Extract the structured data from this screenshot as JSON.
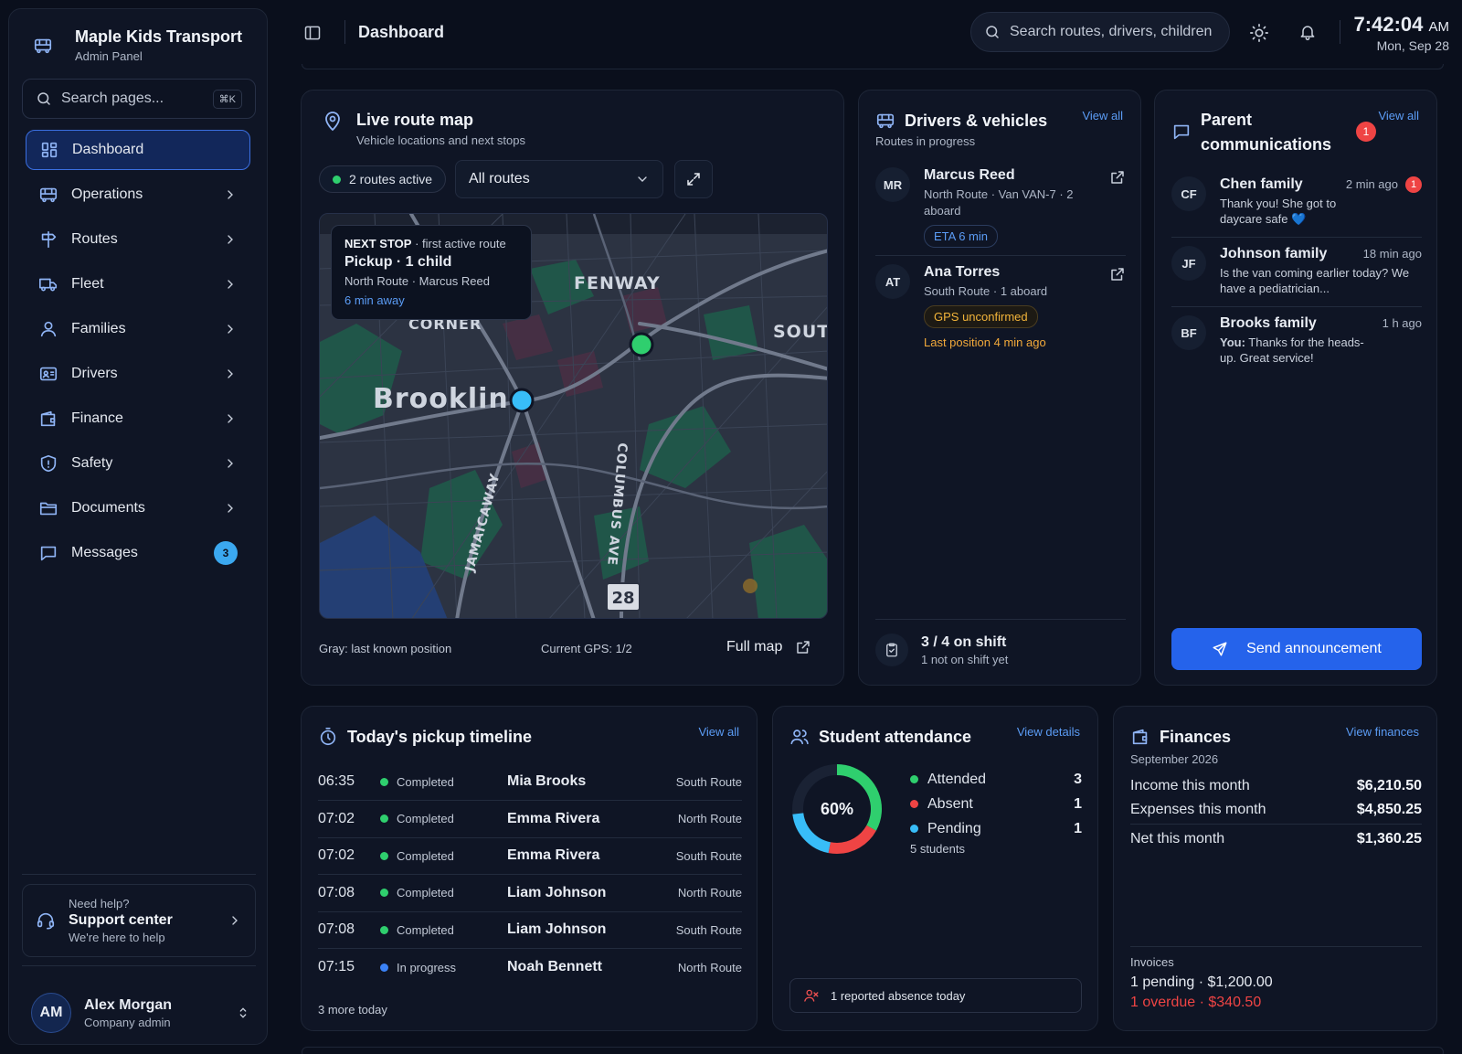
{
  "brand": {
    "name": "Maple Kids Transport",
    "subtitle": "Admin Panel"
  },
  "sidebar": {
    "search_placeholder": "Search pages...",
    "search_shortcut": "⌘K",
    "items": [
      {
        "label": "Dashboard",
        "icon": "grid-icon"
      },
      {
        "label": "Operations",
        "icon": "bus-icon"
      },
      {
        "label": "Routes",
        "icon": "signpost-icon"
      },
      {
        "label": "Fleet",
        "icon": "truck-icon"
      },
      {
        "label": "Families",
        "icon": "users-icon"
      },
      {
        "label": "Drivers",
        "icon": "id-card-icon"
      },
      {
        "label": "Finance",
        "icon": "wallet-icon"
      },
      {
        "label": "Safety",
        "icon": "shield-icon"
      },
      {
        "label": "Documents",
        "icon": "folder-icon"
      },
      {
        "label": "Messages",
        "icon": "message-icon",
        "badge": "3"
      }
    ],
    "support": {
      "title": "Need help?",
      "label": "Support center",
      "sub": "We're here to help"
    },
    "user": {
      "initials": "AM",
      "name": "Alex Morgan",
      "role": "Company admin"
    }
  },
  "topbar": {
    "title": "Dashboard",
    "search_placeholder": "Search routes, drivers, children",
    "time": "7:42:04",
    "ampm": "AM",
    "date": "Mon, Sep 28"
  },
  "map": {
    "title": "Live route map",
    "subtitle": "Vehicle locations and next stops",
    "routes_active": "2 routes active",
    "route_filter": "All routes",
    "tooltip": {
      "label": "NEXT STOP",
      "context": " · first active route",
      "title": "Pickup · 1 child",
      "detail": "North Route · Marcus Reed",
      "eta": "6 min away"
    },
    "places": {
      "fenway": "FENWAY",
      "corner": "CORNER",
      "south": "SOUT",
      "brookline": "Brookline",
      "jamaicaway": "JAMAICAWAY",
      "columbus": "COLUMBUS AVE",
      "shield": "28"
    },
    "footer_gray": "Gray: last known position",
    "footer_gps": "Current GPS: 1/2",
    "full_map": "Full map"
  },
  "drivers": {
    "title": "Drivers & vehicles",
    "subtitle": "Routes in progress",
    "view_all": "View all",
    "list": [
      {
        "initials": "MR",
        "name": "Marcus Reed",
        "detail": "North Route · Van VAN-7 · 2 aboard",
        "pill": "ETA 6 min"
      },
      {
        "initials": "AT",
        "name": "Ana Torres",
        "detail": "South Route · 1 aboard",
        "pill": "GPS unconfirmed",
        "warning": "Last position 4 min ago"
      }
    ],
    "shift_count": "3 / 4 on shift",
    "shift_sub": "1 not on shift yet"
  },
  "parents": {
    "title": "Parent communications",
    "badge": "1",
    "view_all": "View all",
    "messages": [
      {
        "initials": "CF",
        "name": "Chen family",
        "time": "2 min ago",
        "text": "Thank you! She got to daycare safe 💙",
        "unread": "1"
      },
      {
        "initials": "JF",
        "name": "Johnson family",
        "time": "18 min ago",
        "text": "Is the van coming earlier today? We have a pediatrician..."
      },
      {
        "initials": "BF",
        "name": "Brooks family",
        "time": "1 h ago",
        "you": "You:",
        "text": " Thanks for the heads-up. Great service!"
      }
    ],
    "send_label": "Send announcement"
  },
  "timeline": {
    "title": "Today's pickup timeline",
    "view_all": "View all",
    "rows": [
      {
        "time": "06:35",
        "status": "Completed",
        "name": "Mia Brooks",
        "route": "South Route"
      },
      {
        "time": "07:02",
        "status": "Completed",
        "name": "Emma Rivera",
        "route": "North Route"
      },
      {
        "time": "07:02",
        "status": "Completed",
        "name": "Emma Rivera",
        "route": "South Route"
      },
      {
        "time": "07:08",
        "status": "Completed",
        "name": "Liam Johnson",
        "route": "North Route"
      },
      {
        "time": "07:08",
        "status": "Completed",
        "name": "Liam Johnson",
        "route": "South Route"
      },
      {
        "time": "07:15",
        "status": "In progress",
        "name": "Noah Bennett",
        "route": "North Route"
      }
    ],
    "more": "3 more today"
  },
  "attendance": {
    "title": "Student attendance",
    "view_details": "View details",
    "percent": "60%",
    "attended_fraction": 0.6,
    "absent_fraction": 0.2,
    "pending_fraction": 0.2,
    "legend": [
      {
        "label": "Attended",
        "value": "3",
        "color": "#2fcf6e"
      },
      {
        "label": "Absent",
        "value": "1",
        "color": "#ef4444"
      },
      {
        "label": "Pending",
        "value": "1",
        "color": "#38bdf8"
      }
    ],
    "total": "5 students",
    "absence_note": "1 reported absence today"
  },
  "finances": {
    "title": "Finances",
    "period": "September 2026",
    "view": "View finances",
    "income_label": "Income this month",
    "income": "$6,210.50",
    "expenses_label": "Expenses this month",
    "expenses": "$4,850.25",
    "net_label": "Net this month",
    "net": "$1,360.25",
    "invoices_label": "Invoices",
    "pending": "1 pending · $1,200.00",
    "overdue": "1 overdue · $340.50"
  },
  "colors": {
    "accent": "#2563eb",
    "success": "#2fcf6e",
    "danger": "#ef4444",
    "info": "#38bdf8",
    "warning": "#f2b43a"
  }
}
